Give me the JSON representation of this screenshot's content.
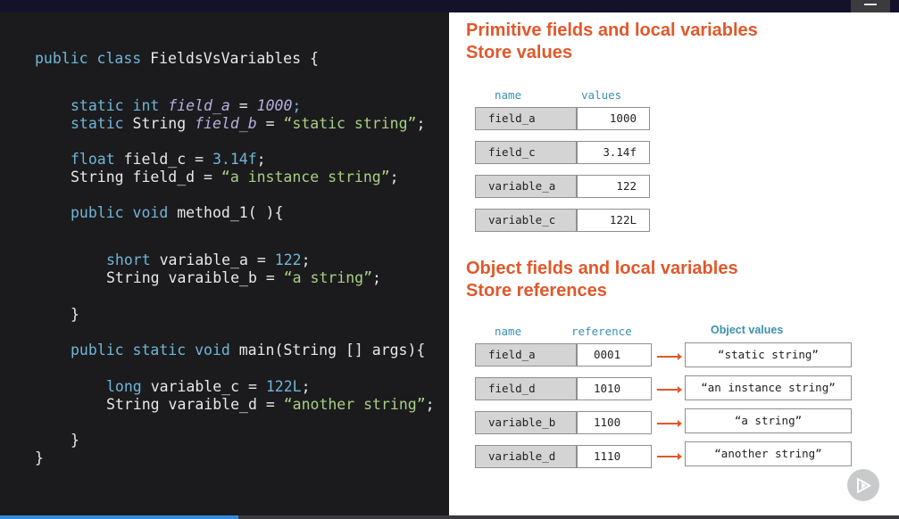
{
  "code": {
    "class_kw": "public class",
    "class_name": "FieldsVsVariables {",
    "l1": {
      "kw": "static int",
      "field": "field_a",
      "eq": "=",
      "val": "1000",
      "end": ";"
    },
    "l2": {
      "kw": "static",
      "type": "String",
      "field": "field_b",
      "eq": "=",
      "val": "“static string”",
      "end": ";"
    },
    "l3": {
      "kw": "float",
      "rest": "field_c =",
      "val": "3.14f",
      "end": ";"
    },
    "l4": {
      "type": "String",
      "rest": "field_d =",
      "val": "“a instance string”",
      "end": ";"
    },
    "l5": {
      "kw": "public void",
      "rest": "method_1( ){"
    },
    "l6": {
      "kw": "short",
      "rest": "variable_a =",
      "val": "122",
      "end": ";"
    },
    "l7": {
      "type": "String",
      "rest": "varaible_b =",
      "val": "“a string”",
      "end": ";"
    },
    "close_method": "}",
    "l8": {
      "kw": "public static void",
      "rest": "main(String [] args){"
    },
    "l9": {
      "kw": "long",
      "rest": "variable_c =",
      "val": "122L",
      "end": ";"
    },
    "l10": {
      "type": "String",
      "rest": "varaible_d =",
      "val": "“another string”",
      "end": ";"
    },
    "close_main": "}",
    "close_class": "}"
  },
  "primitive_section": {
    "heading_line1": "Primitive fields and local variables",
    "heading_line2": "Store values",
    "col_name": "name",
    "col_values": "values",
    "rows": [
      {
        "name": "field_a",
        "value": "1000"
      },
      {
        "name": "field_c",
        "value": "3.14f"
      },
      {
        "name": "variable_a",
        "value": "122"
      },
      {
        "name": "variable_c",
        "value": "122L"
      }
    ]
  },
  "object_section": {
    "heading_line1": "Object fields and local variables",
    "heading_line2": "Store references",
    "col_name": "name",
    "col_reference": "reference",
    "col_object": "Object values",
    "rows": [
      {
        "name": "field_a",
        "reference": "0001",
        "object": "“static string”"
      },
      {
        "name": "field_d",
        "reference": "1010",
        "object": "“an instance string”"
      },
      {
        "name": "variable_b",
        "reference": "1100",
        "object": "“a string”"
      },
      {
        "name": "variable_d",
        "reference": "1110",
        "object": "“another string”"
      }
    ]
  },
  "player": {
    "progress_fraction": 0.265,
    "accent": "#2f8ce0"
  },
  "colors": {
    "heading": "#e0582b",
    "label": "#3c8fb0"
  },
  "icons": {
    "menu": "menu-icon",
    "play": "play-icon"
  }
}
